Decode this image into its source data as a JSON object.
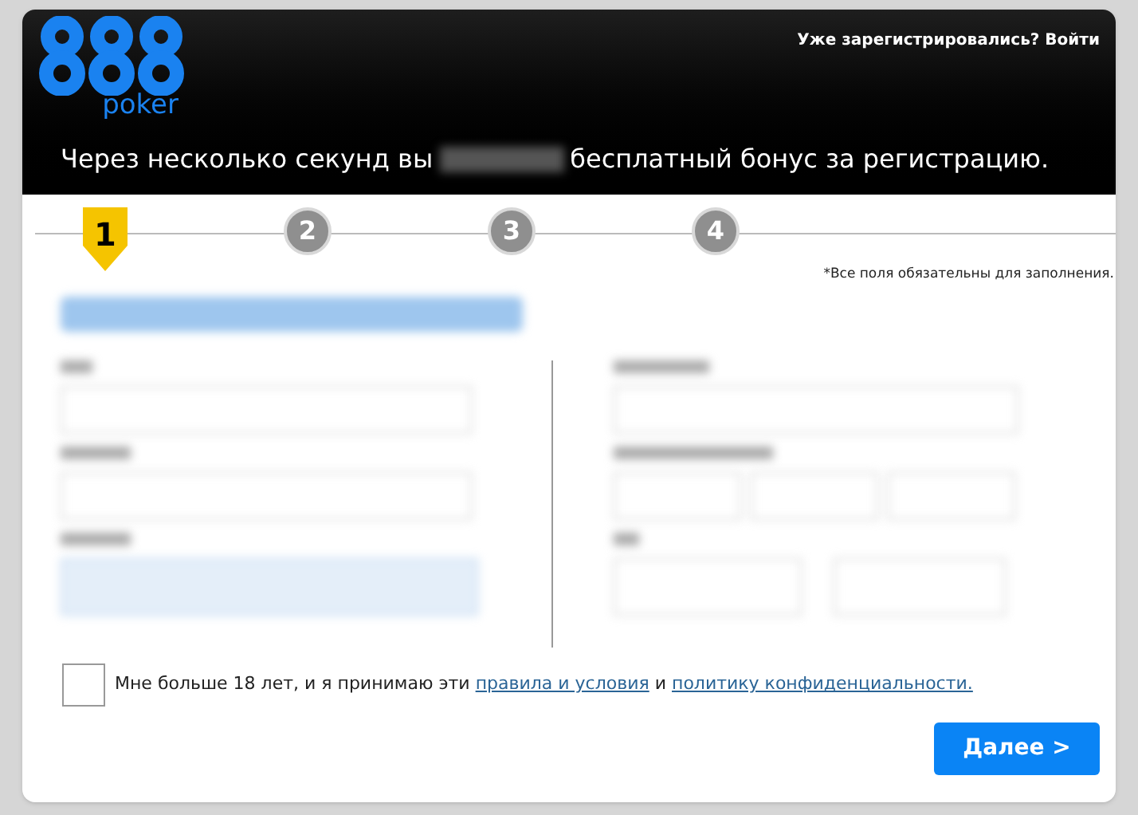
{
  "header": {
    "logo_text": "poker",
    "login_link": "Уже зарегистрировались? Войти",
    "promo_before": "Через несколько секунд вы",
    "promo_after": "бесплатный бонус за регистрацию."
  },
  "steps": [
    {
      "label": "1",
      "selected": true
    },
    {
      "label": "2",
      "selected": false
    },
    {
      "label": "3",
      "selected": false
    },
    {
      "label": "4",
      "selected": false
    }
  ],
  "required_note": "*Все поля обязательны для заполнения.",
  "consent": {
    "checked": false,
    "text": "Мне больше 18 лет, и я принимаю эти",
    "terms_link": "правила и условия",
    "joiner": "и",
    "privacy_link": "политику конфиденциальности."
  },
  "next_button": "Далее >"
}
